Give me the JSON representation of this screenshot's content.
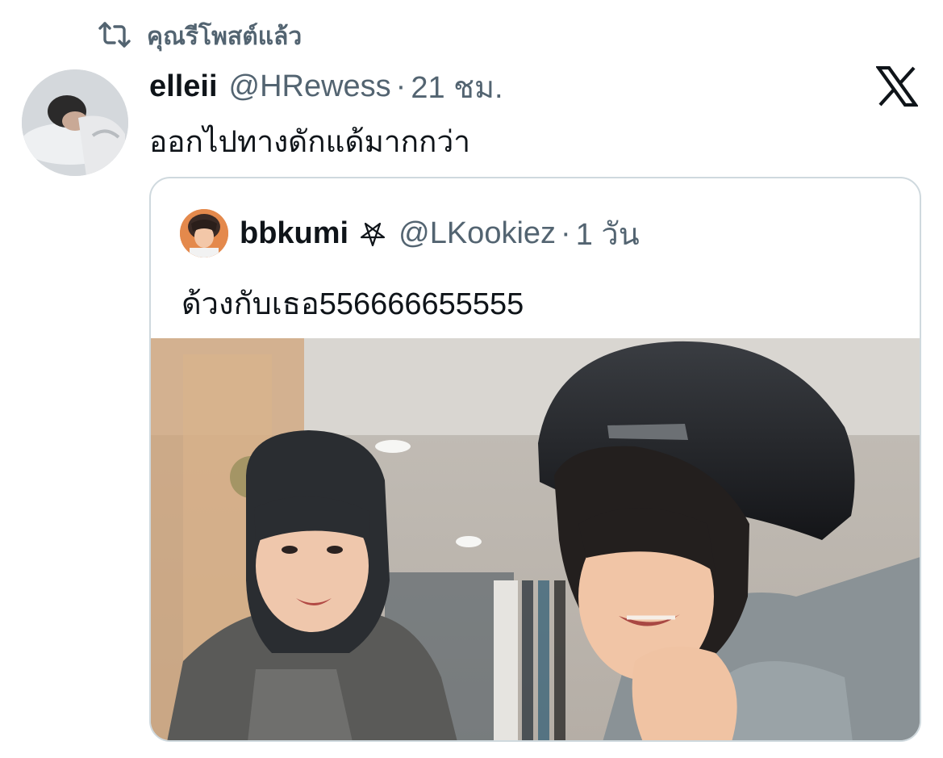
{
  "repost": {
    "label": "คุณรีโพสต์แล้ว",
    "icon": "repost-icon"
  },
  "tweet": {
    "display_name": "elleii",
    "handle": "@HRewess",
    "separator": "·",
    "time": "21 ชม.",
    "text": "ออกไปทางดักแด้มากกว่า"
  },
  "platform": {
    "logo": "x-logo-icon"
  },
  "quote": {
    "display_name": "bbkumi",
    "badge_icon": "pentagram-icon",
    "handle": "@LKookiez",
    "separator": "·",
    "time": "1 วัน",
    "text": "ด้วงกับเธอ556666655555"
  },
  "colors": {
    "secondary_text": "#536471",
    "primary_text": "#0f1419",
    "border": "#cfd9de"
  }
}
